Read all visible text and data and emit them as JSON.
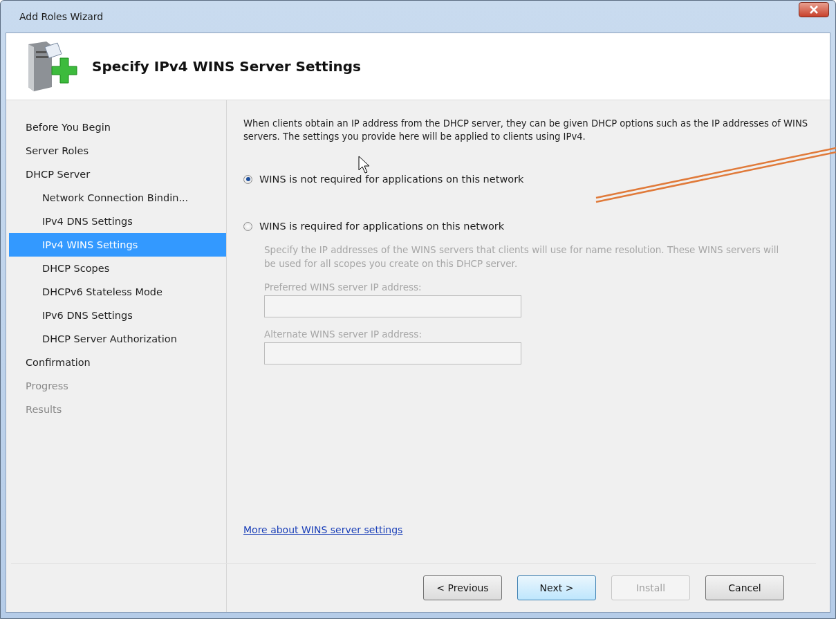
{
  "window": {
    "title": "Add Roles Wizard"
  },
  "header": {
    "title": "Specify IPv4 WINS Server Settings"
  },
  "nav": {
    "items": [
      {
        "label": "Before You Begin",
        "selected": false,
        "disabled": false
      },
      {
        "label": "Server Roles",
        "selected": false,
        "disabled": false
      },
      {
        "label": "DHCP Server",
        "selected": false,
        "disabled": false,
        "children": [
          {
            "label": "Network Connection Bindin...",
            "selected": false,
            "disabled": false
          },
          {
            "label": "IPv4 DNS Settings",
            "selected": false,
            "disabled": false
          },
          {
            "label": "IPv4 WINS Settings",
            "selected": true,
            "disabled": false
          },
          {
            "label": "DHCP Scopes",
            "selected": false,
            "disabled": false
          },
          {
            "label": "DHCPv6 Stateless Mode",
            "selected": false,
            "disabled": false
          },
          {
            "label": "IPv6 DNS Settings",
            "selected": false,
            "disabled": false
          },
          {
            "label": "DHCP Server Authorization",
            "selected": false,
            "disabled": false
          }
        ]
      },
      {
        "label": "Confirmation",
        "selected": false,
        "disabled": false
      },
      {
        "label": "Progress",
        "selected": false,
        "disabled": true
      },
      {
        "label": "Results",
        "selected": false,
        "disabled": true
      }
    ]
  },
  "content": {
    "intro": "When clients obtain an IP address from the DHCP server, they can be given DHCP options such as the IP addresses of WINS servers. The settings you provide here will be applied to clients using IPv4.",
    "options": [
      {
        "label": "WINS is not required for applications on this network",
        "selected": true
      },
      {
        "label": "WINS is required for applications on this network",
        "selected": false
      }
    ],
    "details": {
      "disabled": true,
      "description": "Specify the IP addresses of the WINS servers that clients will use for name resolution. These WINS servers will be used for all scopes you create on this DHCP server.",
      "fields": [
        {
          "label": "Preferred WINS server IP address:"
        },
        {
          "label": "Alternate WINS server IP address:"
        }
      ]
    },
    "link": "More about WINS server settings"
  },
  "buttons": [
    {
      "label": "< Previous",
      "disabled": false,
      "default": false
    },
    {
      "label": "Next >",
      "disabled": false,
      "default": true
    },
    {
      "label": "Install",
      "disabled": true,
      "default": false
    },
    {
      "label": "Cancel",
      "disabled": false,
      "default": false
    }
  ]
}
